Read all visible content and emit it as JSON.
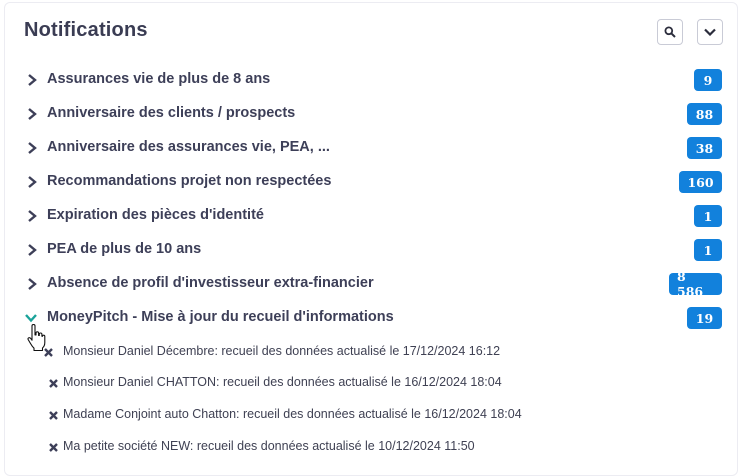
{
  "header": {
    "title": "Notifications",
    "search_icon": "search-icon",
    "collapse_icon": "chevron-down-icon"
  },
  "notifications": [
    {
      "label": "Assurances vie de plus de 8 ans",
      "count": "9",
      "expanded": false
    },
    {
      "label": "Anniversaire des clients / prospects",
      "count": "88",
      "expanded": false
    },
    {
      "label": "Anniversaire des assurances vie, PEA, ...",
      "count": "38",
      "expanded": false
    },
    {
      "label": "Recommandations projet non respectées",
      "count": "160",
      "expanded": false
    },
    {
      "label": "Expiration des pièces d'identité",
      "count": "1",
      "expanded": false
    },
    {
      "label": "PEA de plus de 10 ans",
      "count": "1",
      "expanded": false
    },
    {
      "label": "Absence de profil d'investisseur extra-financier",
      "count": "8 586",
      "expanded": false
    },
    {
      "label": "MoneyPitch - Mise à jour du recueil d'informations",
      "count": "19",
      "expanded": true
    }
  ],
  "expanded_items": [
    "Monsieur Daniel Décembre: recueil des données actualisé le 17/12/2024 16:12",
    "Monsieur Daniel CHATTON: recueil des données actualisé le 16/12/2024 18:04",
    "Madame Conjoint auto Chatton: recueil des données actualisé le 16/12/2024 18:04",
    "Ma petite société NEW: recueil des données actualisé le 10/12/2024 11:50"
  ],
  "colors": {
    "badge": "#1281dc",
    "text": "#3d3f58",
    "expanded_chevron": "#1aa39a"
  }
}
